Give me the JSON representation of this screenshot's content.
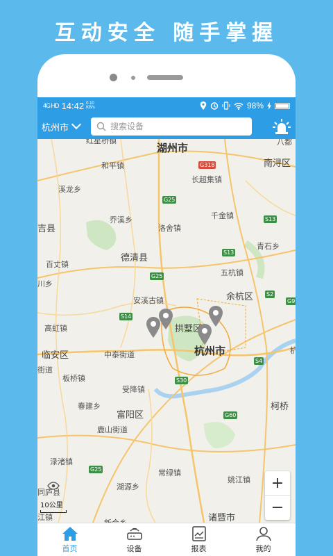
{
  "promo": {
    "title": "互动安全  随手掌握"
  },
  "status_bar": {
    "signal": "4G HD",
    "time": "14:42",
    "net_speed": "0.10 KB/s",
    "battery_text": "98%",
    "battery_level": 0.98
  },
  "topbar": {
    "city": "杭州市",
    "search_placeholder": "搜索设备"
  },
  "map": {
    "places": [
      {
        "name": "红星桥镇"
      },
      {
        "name": "湖州市"
      },
      {
        "name": "八都"
      },
      {
        "name": "和平镇"
      },
      {
        "name": "G318"
      },
      {
        "name": "南浔区"
      },
      {
        "name": "溪龙乡"
      },
      {
        "name": "长超集镇"
      },
      {
        "name": "G25"
      },
      {
        "name": "乔溪乡"
      },
      {
        "name": "千金镇"
      },
      {
        "name": "吉县"
      },
      {
        "name": "洛舍镇"
      },
      {
        "name": "S13"
      },
      {
        "name": "青石乡"
      },
      {
        "name": "德清县"
      },
      {
        "name": "S13"
      },
      {
        "name": "百丈镇"
      },
      {
        "name": "五杭镇"
      },
      {
        "name": "G25"
      },
      {
        "name": "川乡"
      },
      {
        "name": "余杭区"
      },
      {
        "name": "安溪古镇"
      },
      {
        "name": "S2"
      },
      {
        "name": "G9"
      },
      {
        "name": "S14"
      },
      {
        "name": "拱墅区"
      },
      {
        "name": "高虹镇"
      },
      {
        "name": "杭州市"
      },
      {
        "name": "临安区"
      },
      {
        "name": "中泰街道"
      },
      {
        "name": "S4"
      },
      {
        "name": "杭"
      },
      {
        "name": "街道"
      },
      {
        "name": "板桥镇"
      },
      {
        "name": "S30"
      },
      {
        "name": "受降镇"
      },
      {
        "name": "春建乡"
      },
      {
        "name": "富阳区"
      },
      {
        "name": "柯桥"
      },
      {
        "name": "G60"
      },
      {
        "name": "鹿山街道"
      },
      {
        "name": "渌渚镇"
      },
      {
        "name": "G25"
      },
      {
        "name": "常绿镇"
      },
      {
        "name": "湖源乡"
      },
      {
        "name": "姚江镇"
      },
      {
        "name": "同庐县"
      },
      {
        "name": "江镇"
      },
      {
        "name": "诸暨市"
      },
      {
        "name": "新合乡"
      }
    ],
    "scale_label": "10公里",
    "zoom_in": "+",
    "zoom_out": "−"
  },
  "tabs": [
    {
      "label": "首页",
      "icon": "home-icon",
      "active": true
    },
    {
      "label": "设备",
      "icon": "router-icon",
      "active": false
    },
    {
      "label": "报表",
      "icon": "report-icon",
      "active": false
    },
    {
      "label": "我的",
      "icon": "user-icon",
      "active": false
    }
  ],
  "colors": {
    "background": "#5cb9ec",
    "accent": "#2d9ee6",
    "pin": "#8a8a8a",
    "highway_shield": "#3e8e47"
  }
}
